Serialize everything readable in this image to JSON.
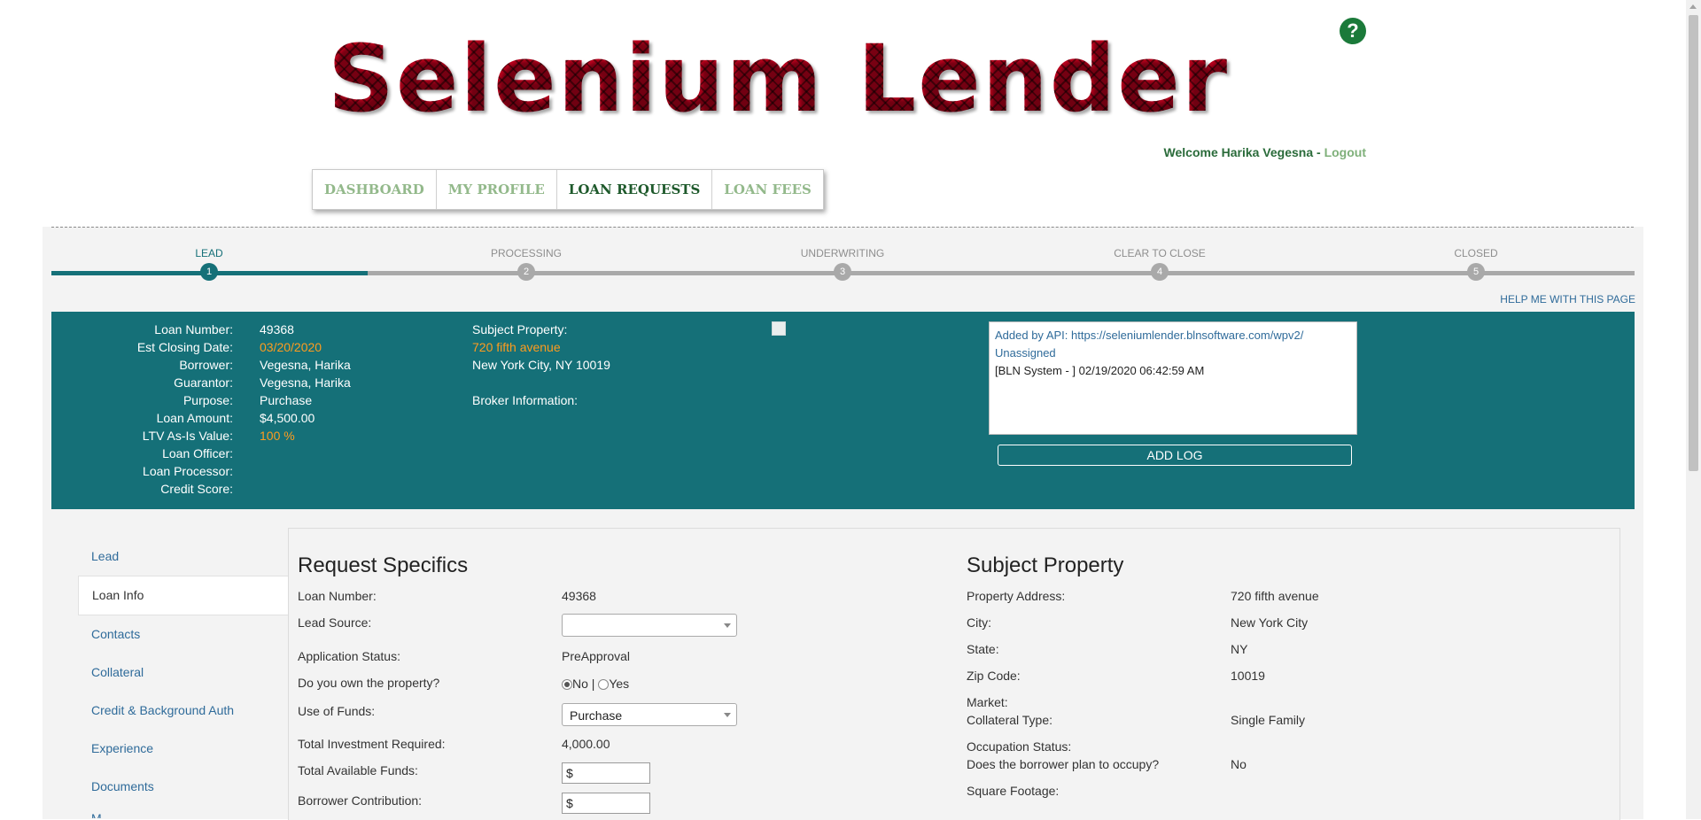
{
  "header": {
    "logo": "Selenium Lender",
    "help_icon": "?",
    "welcome": "Welcome Harika Vegesna",
    "separator": " - ",
    "logout": "Logout"
  },
  "nav": {
    "items": [
      "DASHBOARD",
      "MY PROFILE",
      "LOAN REQUESTS",
      "LOAN FEES"
    ],
    "active": "LOAN REQUESTS"
  },
  "stepper": {
    "steps": [
      {
        "label": "LEAD",
        "num": "1"
      },
      {
        "label": "PROCESSING",
        "num": "2"
      },
      {
        "label": "UNDERWRITING",
        "num": "3"
      },
      {
        "label": "CLEAR TO CLOSE",
        "num": "4"
      },
      {
        "label": "CLOSED",
        "num": "5"
      }
    ],
    "active_index": 0
  },
  "help_page": "HELP ME WITH THIS PAGE",
  "summary": {
    "rows": [
      {
        "k": "Loan Number:",
        "v": "49368"
      },
      {
        "k": "Est Closing Date:",
        "v": "03/20/2020"
      },
      {
        "k": "Borrower:",
        "v": "Vegesna, Harika"
      },
      {
        "k": "Guarantor:",
        "v": "Vegesna, Harika"
      },
      {
        "k": "Purpose:",
        "v": "Purchase"
      },
      {
        "k": "Loan Amount:",
        "v": "$4,500.00"
      },
      {
        "k": "LTV As-Is Value:",
        "v": "100 %"
      },
      {
        "k": "Loan Officer:",
        "v": ""
      },
      {
        "k": "Loan Processor:",
        "v": ""
      },
      {
        "k": "Credit Score:",
        "v": ""
      }
    ],
    "subject_label": "Subject Property:",
    "subject_street": "720 fifth avenue",
    "subject_city": "New York City, NY 10019",
    "broker_label": "Broker Information:",
    "log_link": "Added by API: https://seleniumlender.blnsoftware.com/wpv2/",
    "log_unassigned": "Unassigned",
    "log_entry": "[BLN System - ] 02/19/2020 06:42:59 AM",
    "add_log": "ADD LOG"
  },
  "sidebar": {
    "items": [
      "Lead",
      "Loan Info",
      "Contacts",
      "Collateral",
      "Credit & Background Auth",
      "Experience",
      "Documents",
      "M..."
    ],
    "active": "Loan Info"
  },
  "request_specifics": {
    "title": "Request Specifics",
    "loan_number_label": "Loan Number:",
    "loan_number": "49368",
    "lead_source_label": "Lead Source:",
    "lead_source": "",
    "app_status_label": "Application Status:",
    "app_status": "PreApproval",
    "own_property_label": "Do you own the property?",
    "own_no": "No",
    "own_sep": " | ",
    "own_yes": "Yes",
    "use_of_funds_label": "Use of Funds:",
    "use_of_funds": "Purchase",
    "total_investment_label": "Total Investment Required:",
    "total_investment": "4,000.00",
    "total_funds_label": "Total Available Funds:",
    "total_funds": "$",
    "borrower_contribution_label": "Borrower Contribution:",
    "borrower_contribution": "$"
  },
  "subject_property": {
    "title": "Subject Property",
    "address_label": "Property Address:",
    "address": "720 fifth avenue",
    "city_label": "City:",
    "city": "New York City",
    "state_label": "State:",
    "state": "NY",
    "zip_label": "Zip Code:",
    "zip": "10019",
    "market_label": "Market:",
    "collateral_label": "Collateral Type:",
    "collateral": "Single Family",
    "occupancy_label": "Occupation Status:",
    "occupy_label": "Does the borrower plan to occupy?",
    "occupy": "No",
    "sqft_label": "Square Footage:"
  }
}
